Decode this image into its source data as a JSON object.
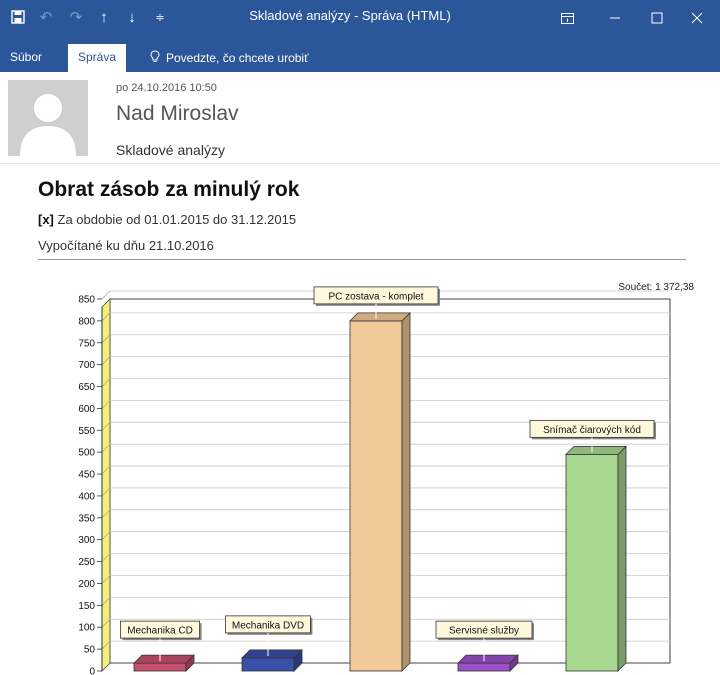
{
  "window": {
    "title": "Skladové analýzy - Správa (HTML)",
    "quick_access": [
      "save-icon",
      "undo-icon",
      "redo-icon",
      "up-arrow-icon",
      "down-arrow-icon",
      "customize-icon"
    ],
    "controls": [
      "ribbon-display-icon",
      "minimize-icon",
      "maximize-icon",
      "close-icon"
    ]
  },
  "ribbon": {
    "tabs": [
      {
        "label": "Súbor",
        "active": false
      },
      {
        "label": "Správa",
        "active": true
      }
    ],
    "tell_me": "Povedzte, čo chcete urobiť"
  },
  "message": {
    "date": "po 24.10.2016 10:50",
    "from": "Nad Miroslav",
    "subject": "Skladové analýzy"
  },
  "report": {
    "title": "Obrat zásob za minulý rok",
    "period_marker": "[x]",
    "period_text": " Za obdobie od 01.01.2015 do 31.12.2015",
    "computed": "Vypočítané ku dňu 21.10.2016"
  },
  "chart_data": {
    "type": "bar",
    "title": "",
    "sum_label": "Součet: 1 372,38",
    "categories": [
      "Mechanika CD",
      "Mechanika DVD",
      "PC zostava - komplet",
      "Servisné služby",
      "Snímač čiarových kód"
    ],
    "values": [
      18,
      30,
      800,
      18,
      495
    ],
    "colors": [
      "#c8506e",
      "#3a4fa8",
      "#f2c998",
      "#9c50c8",
      "#a8d890"
    ],
    "yticks": [
      0,
      50,
      100,
      150,
      200,
      250,
      300,
      350,
      400,
      450,
      500,
      550,
      600,
      650,
      700,
      750,
      800,
      850
    ],
    "ylim": [
      0,
      850
    ],
    "grid": true
  }
}
